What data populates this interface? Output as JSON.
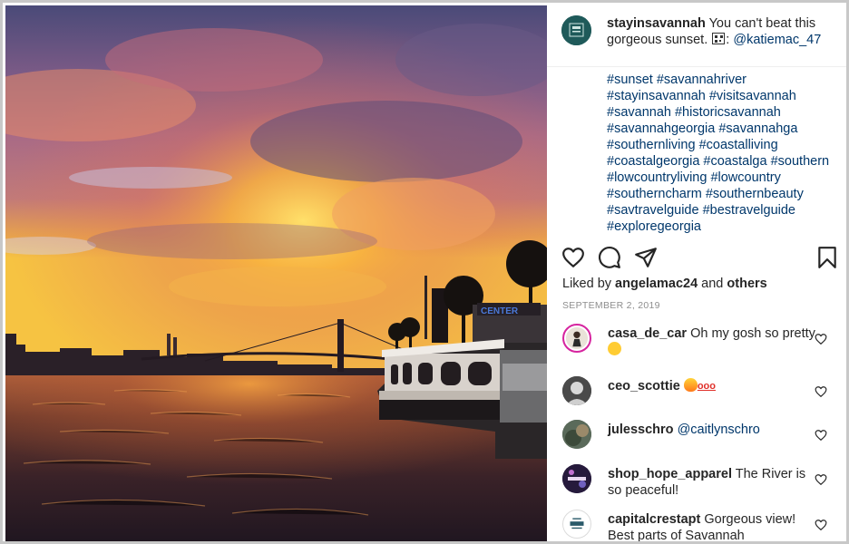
{
  "post": {
    "author": "stayinsavannah",
    "caption_text": "You can't beat this gorgeous sunset.",
    "caption_after_icon": ":",
    "credit": "@katiemac_47",
    "hashtags": [
      "#sunset",
      "#savannahriver",
      "#stayinsavannah",
      "#visitsavannah",
      "#savannah",
      "#historicsavannah",
      "#savannahgeorgia",
      "#savannahga",
      "#southernliving",
      "#coastalliving",
      "#coastalgeorgia",
      "#coastalga",
      "#southern",
      "#lowcountryliving",
      "#lowcountry",
      "#southerncharm",
      "#southernbeauty",
      "#savtravelguide",
      "#bestravelguide",
      "#exploregeorgia"
    ],
    "liked_by_prefix": "Liked by",
    "liked_by_user": "angelamac24",
    "liked_by_and": "and",
    "liked_by_others": "others",
    "date": "SEPTEMBER 2, 2019",
    "photo_sign_text": "CENTER"
  },
  "comments": [
    {
      "user": "casa_de_car",
      "text": "Oh my gosh so pretty",
      "emoji": "heart-eyes-emoji"
    },
    {
      "user": "ceo_scottie",
      "text": "",
      "emoji": "fire-hundred-emoji"
    },
    {
      "user": "julesschro",
      "text": "@caitlynschro",
      "emoji": ""
    },
    {
      "user": "shop_hope_apparel",
      "text": "The River is so peaceful!",
      "emoji": ""
    },
    {
      "user": "capitalcrestapt",
      "text": "Gorgeous view! Best parts of Savannah",
      "emoji": ""
    }
  ],
  "icons": {
    "like": "heart-outline-icon",
    "comment": "speech-bubble-icon",
    "share": "paper-plane-icon",
    "save": "bookmark-icon",
    "comment_like": "small-heart-icon"
  },
  "colors": {
    "link": "#00376b",
    "text": "#262626",
    "muted": "#8e8e8e",
    "brand_avatar": "#1f5a5a",
    "story_ring": "#d6249f"
  }
}
